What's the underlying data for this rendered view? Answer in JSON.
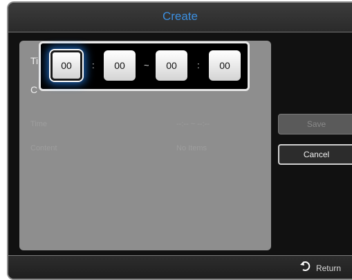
{
  "dialog": {
    "title": "Create"
  },
  "form": {
    "partial_label_1": "Ti",
    "partial_label_2": "C",
    "fields": [
      {
        "label": "Time",
        "value": "--:-- ~ --:--"
      },
      {
        "label": "Content",
        "value": "No Items"
      }
    ]
  },
  "buttons": {
    "save": "Save",
    "cancel": "Cancel"
  },
  "footer": {
    "return_label": "Return"
  },
  "time_picker": {
    "values": [
      "00",
      "00",
      "00",
      "00"
    ],
    "separators": [
      ":",
      "~",
      ":"
    ],
    "selected_index": 0
  }
}
